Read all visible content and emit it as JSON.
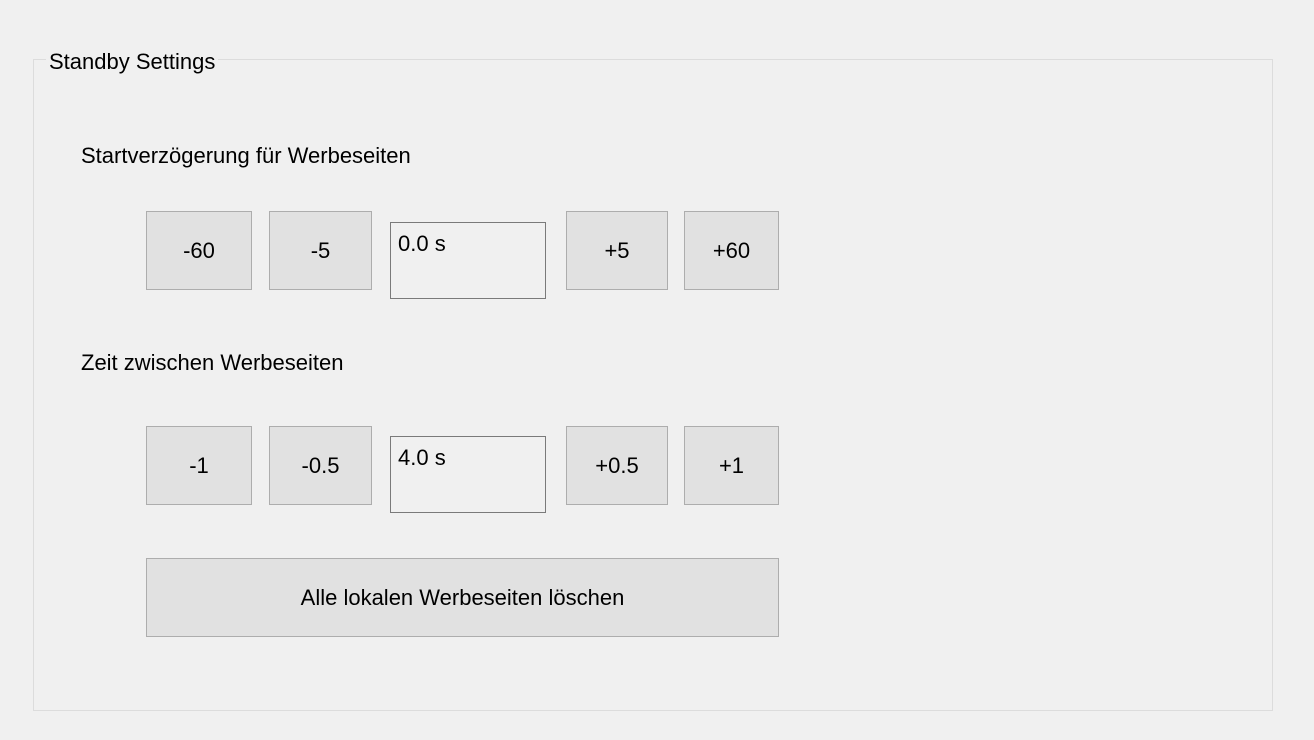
{
  "group": {
    "title": "Standby Settings"
  },
  "start_delay": {
    "label": "Startverzögerung für Werbeseiten",
    "buttons": [
      "-60",
      "-5",
      "+5",
      "+60"
    ],
    "value": "0.0 s"
  },
  "interval": {
    "label": "Zeit zwischen Werbeseiten",
    "buttons": [
      "-1",
      "-0.5",
      "+0.5",
      "+1"
    ],
    "value": "4.0 s"
  },
  "delete_all": {
    "label": "Alle lokalen Werbeseiten löschen"
  }
}
